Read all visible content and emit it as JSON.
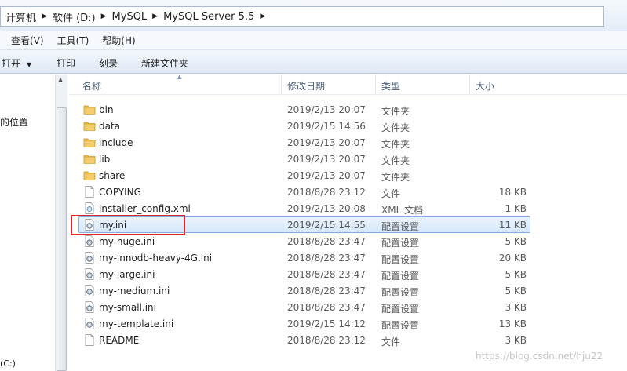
{
  "breadcrumb": [
    "计算机",
    "软件 (D:)",
    "MySQL",
    "MySQL Server 5.5"
  ],
  "menu": [
    "查看(V)",
    "工具(T)",
    "帮助(H)"
  ],
  "toolbar": {
    "open_label": "打开",
    "print_label": "打印",
    "burn_label": "刻录",
    "new_folder_label": "新建文件夹"
  },
  "nav": {
    "partial_label": "的位置",
    "bottom_partial": "(C:)"
  },
  "columns": {
    "name": "名称",
    "date": "修改日期",
    "type": "类型",
    "size": "大小"
  },
  "files": [
    {
      "name": "bin",
      "date": "2019/2/13 20:07",
      "type": "文件夹",
      "size": "",
      "icon": "folder-icon"
    },
    {
      "name": "data",
      "date": "2019/2/15 14:56",
      "type": "文件夹",
      "size": "",
      "icon": "folder-icon"
    },
    {
      "name": "include",
      "date": "2019/2/13 20:07",
      "type": "文件夹",
      "size": "",
      "icon": "folder-icon"
    },
    {
      "name": "lib",
      "date": "2019/2/13 20:07",
      "type": "文件夹",
      "size": "",
      "icon": "folder-icon"
    },
    {
      "name": "share",
      "date": "2019/2/13 20:07",
      "type": "文件夹",
      "size": "",
      "icon": "folder-icon"
    },
    {
      "name": "COPYING",
      "date": "2018/8/28 23:12",
      "type": "文件",
      "size": "18 KB",
      "icon": "file-icon"
    },
    {
      "name": "installer_config.xml",
      "date": "2019/2/13 20:08",
      "type": "XML 文档",
      "size": "1 KB",
      "icon": "xml-file-icon"
    },
    {
      "name": "my.ini",
      "date": "2019/2/15 14:55",
      "type": "配置设置",
      "size": "11 KB",
      "icon": "config-file-icon",
      "selected": true
    },
    {
      "name": "my-huge.ini",
      "date": "2018/8/28 23:47",
      "type": "配置设置",
      "size": "5 KB",
      "icon": "config-file-icon"
    },
    {
      "name": "my-innodb-heavy-4G.ini",
      "date": "2018/8/28 23:47",
      "type": "配置设置",
      "size": "20 KB",
      "icon": "config-file-icon"
    },
    {
      "name": "my-large.ini",
      "date": "2018/8/28 23:47",
      "type": "配置设置",
      "size": "5 KB",
      "icon": "config-file-icon"
    },
    {
      "name": "my-medium.ini",
      "date": "2018/8/28 23:47",
      "type": "配置设置",
      "size": "5 KB",
      "icon": "config-file-icon"
    },
    {
      "name": "my-small.ini",
      "date": "2018/8/28 23:47",
      "type": "配置设置",
      "size": "3 KB",
      "icon": "config-file-icon"
    },
    {
      "name": "my-template.ini",
      "date": "2019/2/15 14:12",
      "type": "配置设置",
      "size": "13 KB",
      "icon": "config-file-icon"
    },
    {
      "name": "README",
      "date": "2018/8/28 23:12",
      "type": "文件",
      "size": "3 KB",
      "icon": "file-icon"
    }
  ],
  "watermark": "https://blog.csdn.net/hju22",
  "colors": {
    "folder": "#e8b84a",
    "selection_border": "#84acdd",
    "highlight_box": "#e0262b"
  }
}
